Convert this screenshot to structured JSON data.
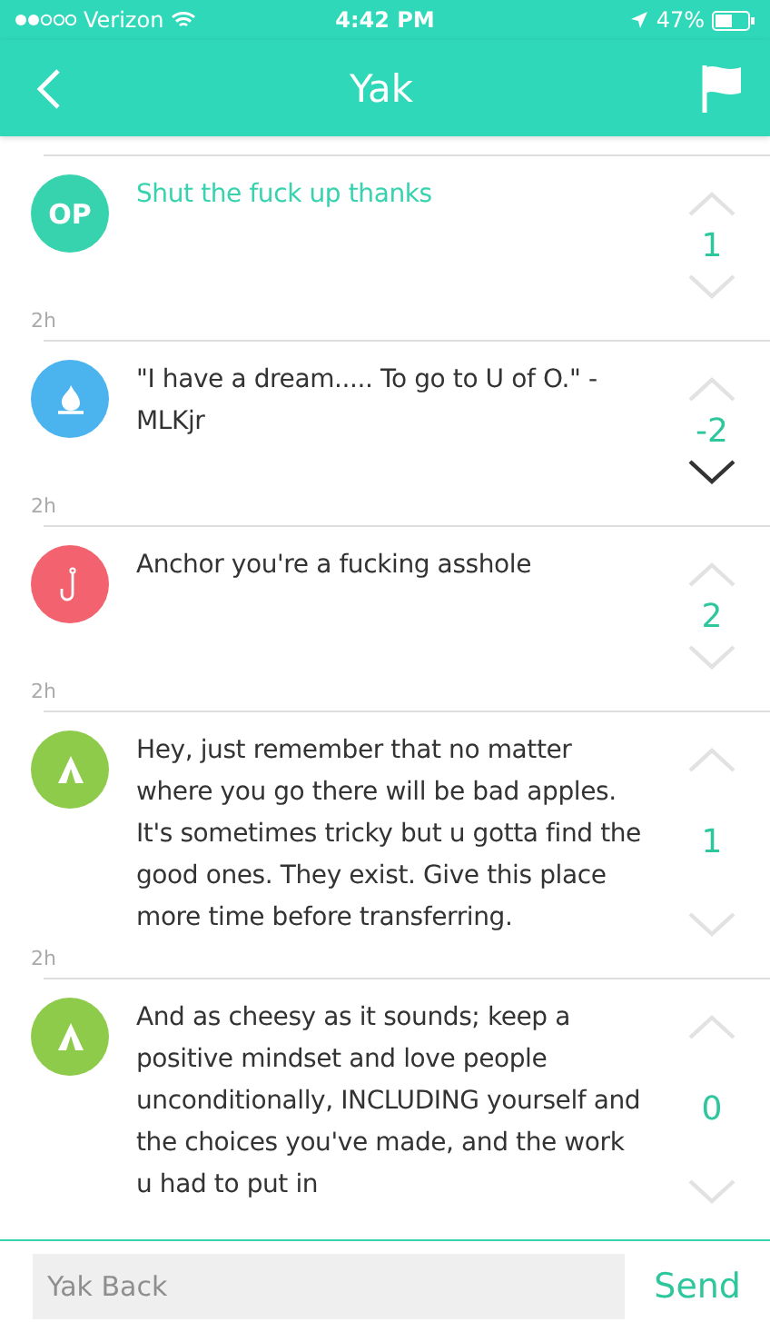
{
  "status_bar": {
    "carrier": "Verizon",
    "time": "4:42 PM",
    "battery": "47%"
  },
  "nav": {
    "title": "Yak"
  },
  "comments": [
    {
      "avatar": {
        "kind": "op",
        "label": "OP",
        "color": "#37d2ae"
      },
      "text": "Shut the fuck up thanks",
      "is_op": true,
      "score": "1",
      "downvoted": false,
      "time": "2h"
    },
    {
      "avatar": {
        "kind": "fire",
        "color": "#4bb3ee"
      },
      "text": "\"I have a dream..... To go to U of O.\" - MLKjr",
      "is_op": false,
      "score": "-2",
      "downvoted": true,
      "time": "2h"
    },
    {
      "avatar": {
        "kind": "hook",
        "color": "#f2636f"
      },
      "text": "Anchor you're a fucking asshole",
      "is_op": false,
      "score": "2",
      "downvoted": false,
      "time": "2h"
    },
    {
      "avatar": {
        "kind": "tent",
        "color": "#8fcb4b"
      },
      "text": "Hey, just remember that no matter where you go there will be bad apples. It's sometimes tricky but u gotta find the good ones. They exist. Give this place more time before transferring.",
      "is_op": false,
      "score": "1",
      "downvoted": false,
      "time": "2h"
    },
    {
      "avatar": {
        "kind": "tent",
        "color": "#8fcb4b"
      },
      "text": "And as cheesy as it sounds; keep a positive mindset and love people unconditionally, INCLUDING yourself and the choices you've made, and the work u had to put in",
      "is_op": false,
      "score": "0",
      "downvoted": false
    }
  ],
  "reply": {
    "placeholder": "Yak Back",
    "send": "Send"
  }
}
